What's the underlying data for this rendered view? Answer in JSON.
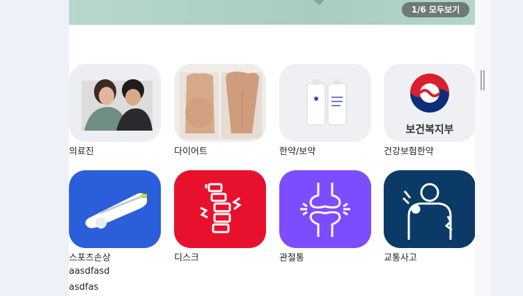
{
  "banner": {
    "pager_text": "1/6 모두보기"
  },
  "categories": [
    {
      "label": "의료진",
      "icon": "medical-staff-photo"
    },
    {
      "label": "다이어트",
      "icon": "diet-body-photo"
    },
    {
      "label": "한약/보약",
      "icon": "herbal-medicine-pouch"
    },
    {
      "label": "건강보험한약",
      "icon": "health-ministry-logo",
      "logo_text": "보건복지부"
    },
    {
      "label": "스포츠손상",
      "icon": "sports-injury-device-icon",
      "bg": "#2b5fd9"
    },
    {
      "label": "디스크",
      "icon": "spine-disc-icon",
      "bg": "#e8112d"
    },
    {
      "label": "관절통",
      "icon": "joint-pain-icon",
      "bg": "#7c4dff"
    },
    {
      "label": "교통사고",
      "icon": "traffic-accident-icon",
      "bg": "#0c3a66"
    }
  ],
  "extra_lines": [
    "aasdfasd",
    "asdfas"
  ]
}
